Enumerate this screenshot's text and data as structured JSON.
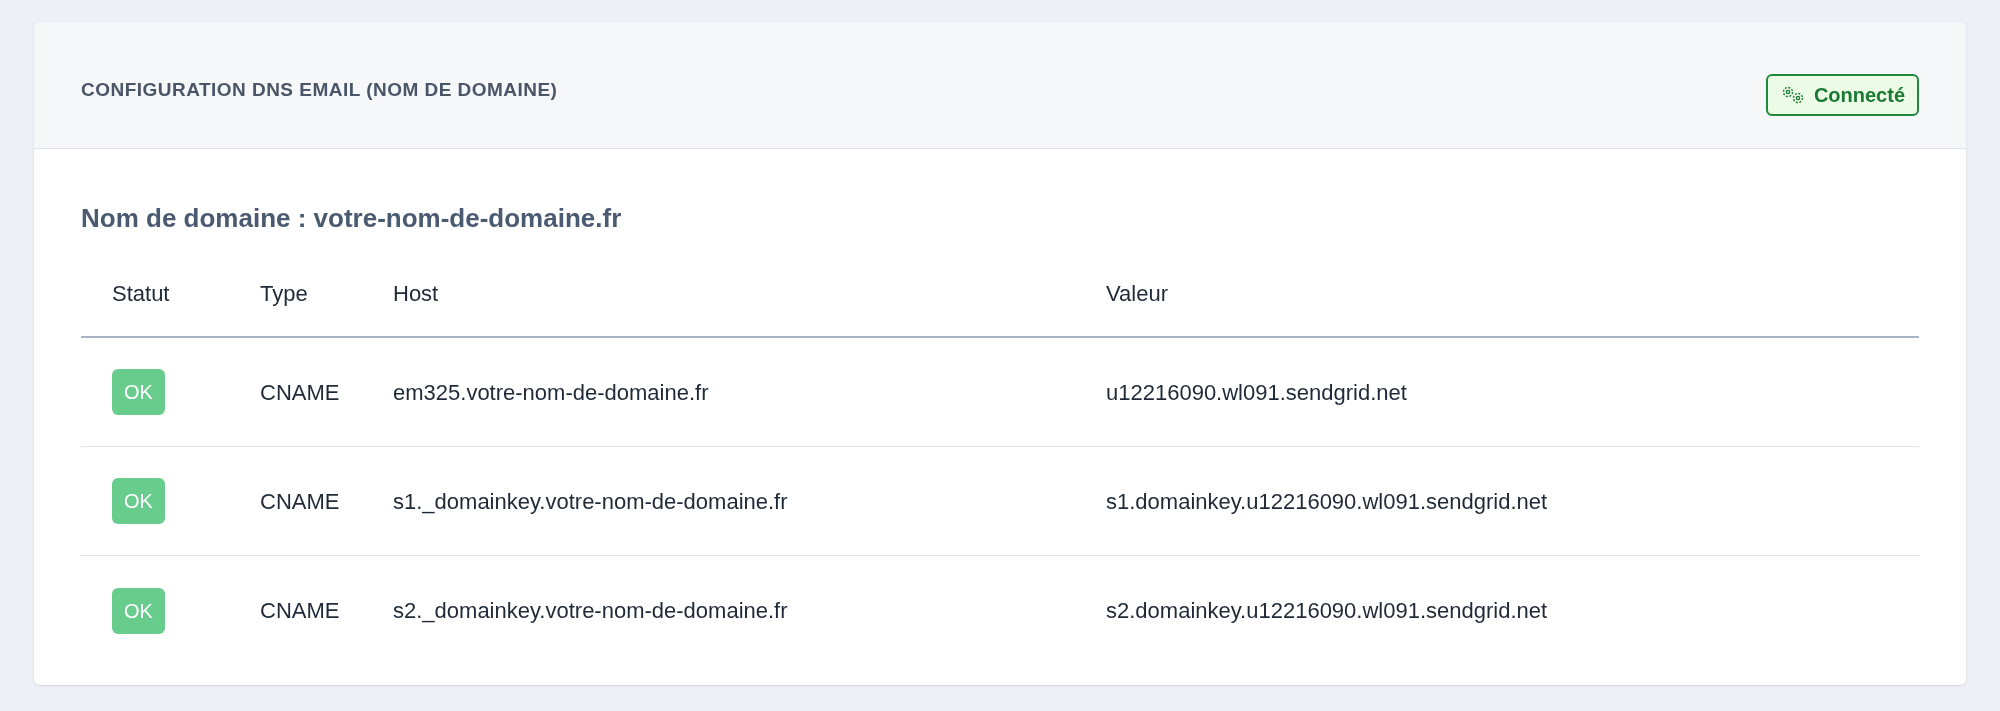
{
  "card": {
    "title": "CONFIGURATION DNS EMAIL (NOM DE DOMAINE)",
    "badge": {
      "label": "Connecté",
      "kind": "success"
    }
  },
  "domain_heading": "Nom de domaine : votre-nom-de-domaine.fr",
  "table": {
    "columns": [
      "Statut",
      "Type",
      "Host",
      "Valeur"
    ],
    "rows": [
      {
        "status": {
          "label": "OK",
          "kind": "success"
        },
        "type": "CNAME",
        "host": "em325.votre-nom-de-domaine.fr",
        "value": "u12216090.wl091.sendgrid.net"
      },
      {
        "status": {
          "label": "OK",
          "kind": "success"
        },
        "type": "CNAME",
        "host": "s1._domainkey.votre-nom-de-domaine.fr",
        "value": "s1.domainkey.u12216090.wl091.sendgrid.net"
      },
      {
        "status": {
          "label": "OK",
          "kind": "success"
        },
        "type": "CNAME",
        "host": "s2._domainkey.votre-nom-de-domaine.fr",
        "value": "s2.domainkey.u12216090.wl091.sendgrid.net"
      }
    ]
  }
}
